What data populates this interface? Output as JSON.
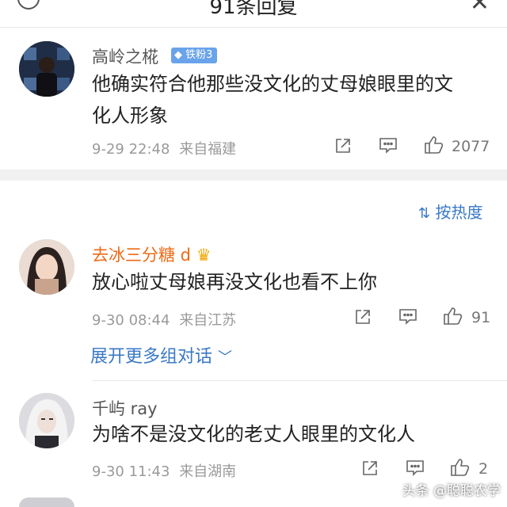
{
  "header": {
    "title": "91条回复"
  },
  "comments": [
    {
      "user": "高岭之椛",
      "badge": "铁粉3",
      "text_line1": "他确实符合他那些没文化的丈母娘眼里的文",
      "text_line2": "化人形象",
      "date": "9-29 22:48",
      "location": "来自福建",
      "likes": "2077"
    },
    {
      "user": "去冰三分糖 d",
      "text": "放心啦丈母娘再没文化也看不上你",
      "date": "9-30 08:44",
      "location": "来自江苏",
      "likes": "91",
      "expand": "展开更多组对话"
    },
    {
      "user": "千屿 ray",
      "text": "为啥不是没文化的老丈人眼里的文化人",
      "date": "9-30 11:43",
      "location": "来自湖南",
      "likes": "2"
    }
  ],
  "sort": {
    "label": "按热度"
  },
  "watermark": "头条 @聪聪农学",
  "colors": {
    "link_blue": "#3a78c7",
    "vip_orange": "#ee6a16",
    "badge_blue": "#69a3ea"
  }
}
